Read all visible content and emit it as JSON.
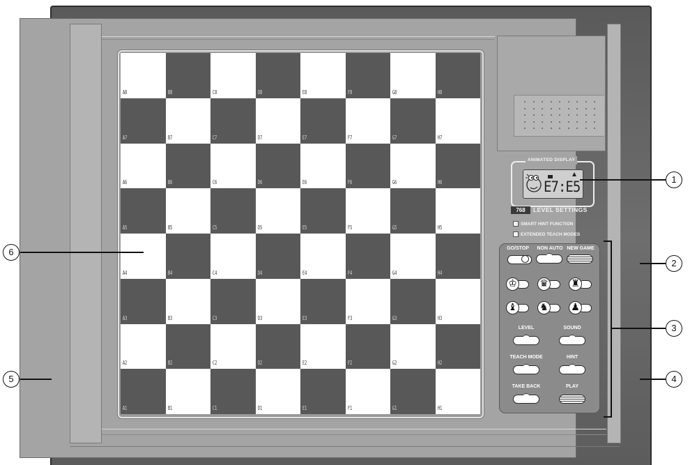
{
  "board": {
    "files": [
      "A",
      "B",
      "C",
      "D",
      "E",
      "F",
      "G",
      "H"
    ],
    "ranks": [
      8,
      7,
      6,
      5,
      4,
      3,
      2,
      1
    ],
    "dark_color": "#585858",
    "light_color": "#ffffff"
  },
  "display": {
    "title": "ANIMATED DISPLAY",
    "lcd_text": "E7:E5",
    "level_count": "768",
    "level_label": "LEVEL SETTINGS",
    "features": [
      "SMART HINT FUNCTION",
      "EXTENDED TEACH MODES"
    ]
  },
  "controls": {
    "go_stop": "GO/STOP",
    "non_auto": "NON AUTO",
    "new_game": "NEW GAME",
    "pieces": [
      {
        "name": "king",
        "glyph": "♔"
      },
      {
        "name": "queen",
        "glyph": "♛"
      },
      {
        "name": "rook",
        "glyph": "♜"
      },
      {
        "name": "bishop",
        "glyph": "♝"
      },
      {
        "name": "knight",
        "glyph": "♞"
      },
      {
        "name": "pawn",
        "glyph": "♟"
      }
    ],
    "level": "LEVEL",
    "sound": "SOUND",
    "teach_mode": "TEACH MODE",
    "hint": "HINT",
    "take_back": "TAKE BACK",
    "play": "PLAY"
  },
  "callouts": {
    "c1": "1",
    "c2": "2",
    "c3": "3",
    "c4": "4",
    "c5": "5",
    "c6": "6"
  }
}
